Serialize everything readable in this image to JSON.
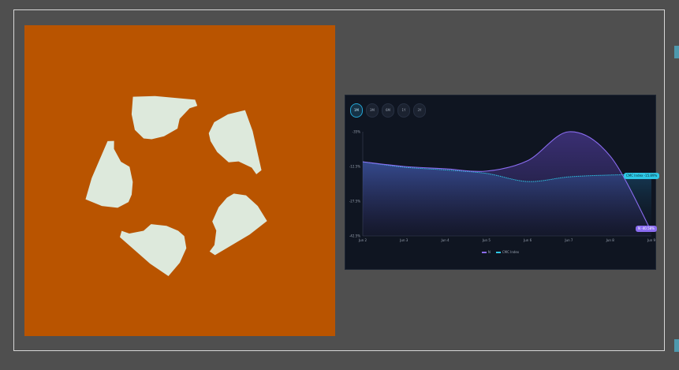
{
  "colors": {
    "background": "#4f4f4f",
    "logo_background": "#b95400",
    "logo_petal": "#dde9dc",
    "chart_background": "#0f1521",
    "series_primary": "#8a6cf0",
    "series_index": "#2ec8e6"
  },
  "logo": {
    "icon": "five-petal-flower-logo"
  },
  "chart_tabs": [
    {
      "label": "1M",
      "active": true
    },
    {
      "label": "3M",
      "active": false
    },
    {
      "label": "6M",
      "active": false
    },
    {
      "label": "1Y",
      "active": false
    },
    {
      "label": "3Y",
      "active": false
    }
  ],
  "chart_data": {
    "type": "area",
    "x": [
      "Jun 2",
      "Jun 3",
      "Jun 4",
      "Jun 5",
      "Jun 6",
      "Jun 7",
      "Jun 8",
      "Jun 9"
    ],
    "yticks": [
      "-35%",
      "-12.5%",
      "-27.5%",
      "-42.5%"
    ],
    "ylim": [
      -42.5,
      2.5
    ],
    "series": [
      {
        "name": "N",
        "values": [
          -10.5,
          -12.5,
          -13.5,
          -14.5,
          -10.0,
          2.5,
          -8.0,
          -40.6
        ]
      },
      {
        "name": "CMC Index",
        "values": [
          -10.5,
          -12.8,
          -14.0,
          -15.5,
          -19.0,
          -17.0,
          -16.2,
          -15.9
        ]
      }
    ],
    "end_labels": {
      "primary": "N -40.58%",
      "index": "CMC Index -15.89%"
    },
    "legend_position": "bottom-center",
    "grid": false
  }
}
